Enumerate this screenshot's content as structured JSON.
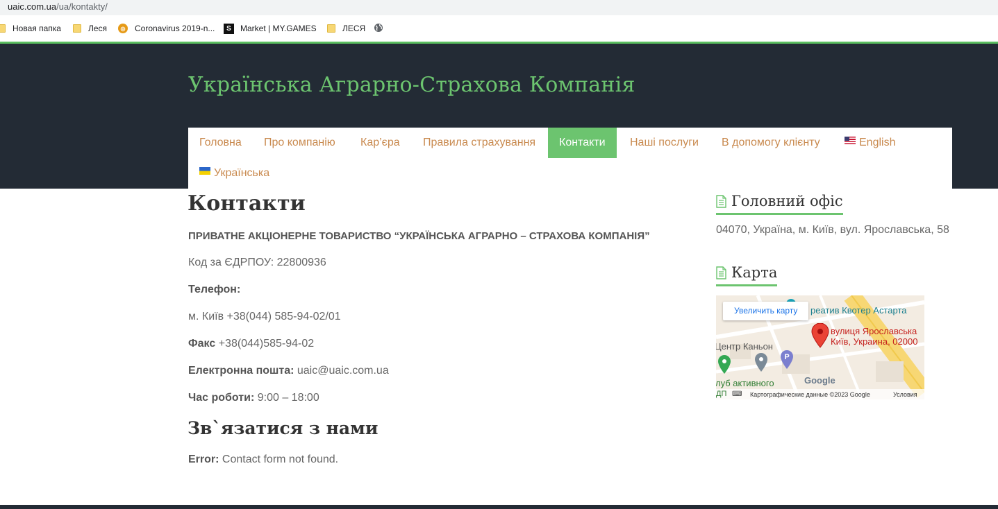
{
  "browser": {
    "url_domain": "uaic.com.ua",
    "url_path": "/ua/kontakty/",
    "bookmarks": [
      {
        "label": "Новая папка",
        "icon": "folder-icon"
      },
      {
        "label": "Леся",
        "icon": "folder-icon"
      },
      {
        "label": "Coronavirus 2019-n...",
        "icon": "coronavirus-site-icon"
      },
      {
        "label": "Market | MY.GAMES",
        "icon": "mygames-icon"
      },
      {
        "label": "ЛЕСЯ",
        "icon": "folder-icon"
      }
    ]
  },
  "site": {
    "title": "Українська Аграрно-Страхова Компанія",
    "accent_color": "#6cc46f",
    "header_bg": "#232b35",
    "link_color": "#c98a4f"
  },
  "nav": {
    "items": [
      {
        "label": "Головна"
      },
      {
        "label": "Про компанію"
      },
      {
        "label": "Кар’єра"
      },
      {
        "label": "Правила страхування"
      },
      {
        "label": "Контакти",
        "active": true
      },
      {
        "label": "Наші послуги"
      },
      {
        "label": "В допомогу клієнту"
      },
      {
        "label": "English",
        "icon": "us-flag-icon"
      },
      {
        "label": "Українська",
        "icon": "ua-flag-icon"
      }
    ]
  },
  "main": {
    "title": "Контакти",
    "company": "ПРИВАТНЕ АКЦІОНЕРНЕ ТОВАРИСТВО “УКРАЇНСЬКА АГРАРНО – СТРАХОВА КОМПАНІЯ”",
    "edrpou": "Код за ЄДРПОУ: 22800936",
    "phone_label": "Телефон:",
    "phone_value": "м. Київ +38(044) 585-94-02/01",
    "fax_label": "Факс",
    "fax_value": " +38(044)585-94-02",
    "email_label": "Електронна пошта:",
    "email_value": " uaic@uaic.com.ua",
    "hours_label": "Час роботи:",
    "hours_value": " 9:00 – 18:00",
    "contact_title": "Зв`язатися з нами",
    "error_label": "Error:",
    "error_text": " Contact form not found."
  },
  "sidebar": {
    "office_title": "Головний офіс",
    "office_address": "04070, Україна, м. Київ, вул. Ярославська, 58",
    "map_title": "Карта",
    "map": {
      "enlarge_button": "Увеличить карту",
      "label_top": "реатив Квотер Астарта",
      "pin_label_1": "вулиця Ярославська",
      "pin_label_2": "Київ, Украина, 02000",
      "label_center": "Центр Каньон",
      "label_club": "луб активного",
      "label_dp": "ДП",
      "google_logo": "Google",
      "map_data": "Картографические данные ©2023 Google",
      "terms": "Условия"
    }
  }
}
